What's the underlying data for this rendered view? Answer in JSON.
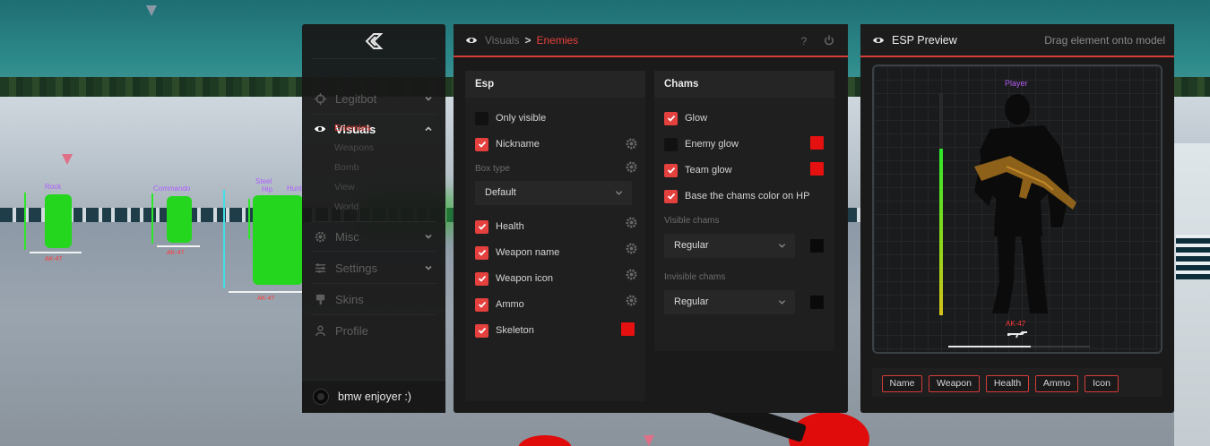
{
  "window": {
    "sidebar": {
      "nav": [
        {
          "label": "Legitbot",
          "icon": "crosshair-icon"
        },
        {
          "label": "Visuals",
          "icon": "eye-icon"
        },
        {
          "label": "Misc",
          "icon": "gear-icon"
        },
        {
          "label": "Settings",
          "icon": "sliders-icon"
        },
        {
          "label": "Skins",
          "icon": "brush-icon"
        },
        {
          "label": "Profile",
          "icon": "user-icon"
        }
      ],
      "visuals_subitems": [
        "Enemies",
        "Weapons",
        "Bomb",
        "View",
        "World"
      ],
      "active_subitem": "Enemies",
      "user_name": "bmw enjoyer :)"
    },
    "main": {
      "breadcrumb": {
        "section": "Visuals",
        "separator": ">",
        "page": "Enemies"
      },
      "help_label": "?",
      "esp": {
        "title": "Esp",
        "only_visible": {
          "label": "Only visible",
          "checked": false
        },
        "nickname": {
          "label": "Nickname",
          "checked": true
        },
        "box_type_label": "Box type",
        "box_type_value": "Default",
        "health": {
          "label": "Health",
          "checked": true
        },
        "weapon_name": {
          "label": "Weapon name",
          "checked": true
        },
        "weapon_icon": {
          "label": "Weapon icon",
          "checked": true
        },
        "ammo": {
          "label": "Ammo",
          "checked": true
        },
        "skeleton": {
          "label": "Skeleton",
          "checked": true,
          "color": "#e51010"
        }
      },
      "chams": {
        "title": "Chams",
        "glow": {
          "label": "Glow",
          "checked": true
        },
        "enemy_glow": {
          "label": "Enemy glow",
          "checked": false,
          "color": "#e51010"
        },
        "team_glow": {
          "label": "Team glow",
          "checked": true,
          "color": "#e51010"
        },
        "base_on_hp": {
          "label": "Base the chams color on HP",
          "checked": true
        },
        "visible_chams_label": "Visible chams",
        "visible_chams_value": "Regular",
        "visible_chams_color": "#0a0a0a",
        "invisible_chams_label": "Invisible chams",
        "invisible_chams_value": "Regular",
        "invisible_chams_color": "#0a0a0a"
      }
    },
    "preview": {
      "title": "ESP Preview",
      "hint": "Drag element onto model",
      "player_tag": "Player",
      "weapon_tag": "AK-47",
      "health_fraction": 0.75,
      "ammo_fraction": 0.58,
      "chips": [
        "Name",
        "Weapon",
        "Health",
        "Ammo",
        "Icon"
      ]
    }
  },
  "game_overlay": {
    "players": [
      "Rock",
      "Commando",
      "Steel",
      "Hip",
      "Hunt"
    ],
    "weapon_tag": "AK-47"
  },
  "colors": {
    "accent": "#e4403e",
    "panel": "#1a1a1a",
    "esp_name": "#b15cf2",
    "glow_green": "#25d61f"
  }
}
